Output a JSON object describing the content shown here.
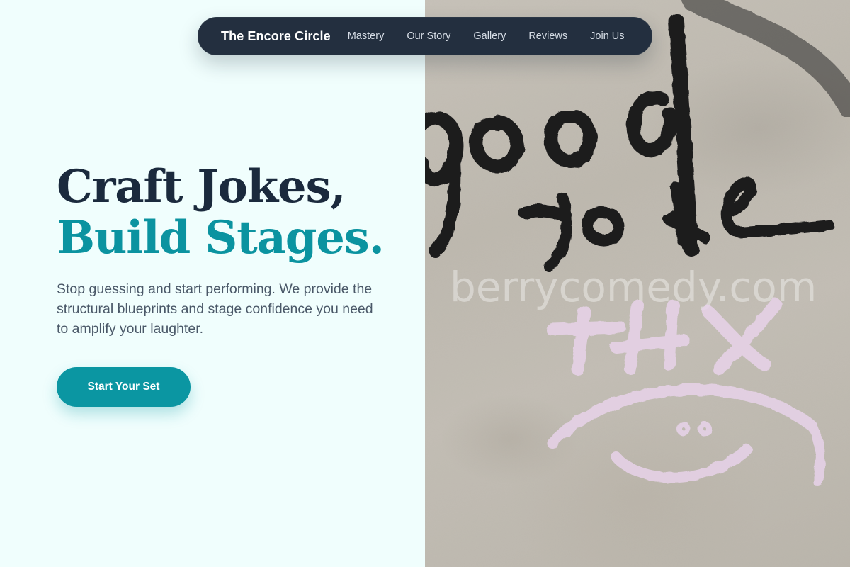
{
  "nav": {
    "brand": "The Encore Circle",
    "links": [
      "Mastery",
      "Our Story",
      "Gallery",
      "Reviews",
      "Join Us"
    ]
  },
  "hero": {
    "title_line1": "Craft Jokes,",
    "title_line2": "Build Stages.",
    "description": "Stop guessing and start performing. We provide the structural blueprints and stage confidence you need to amplify your laughter.",
    "cta_label": "Start Your Set"
  },
  "photo": {
    "graffiti_text": "good joke",
    "watermark": "berrycomedy.com",
    "pink_text": "+HX"
  },
  "colors": {
    "page_bg": "#f0fefd",
    "nav_bg": "#232f3f",
    "title_dark": "#1b2a3d",
    "accent_teal": "#0b93a0",
    "body_text": "#4a5868"
  }
}
